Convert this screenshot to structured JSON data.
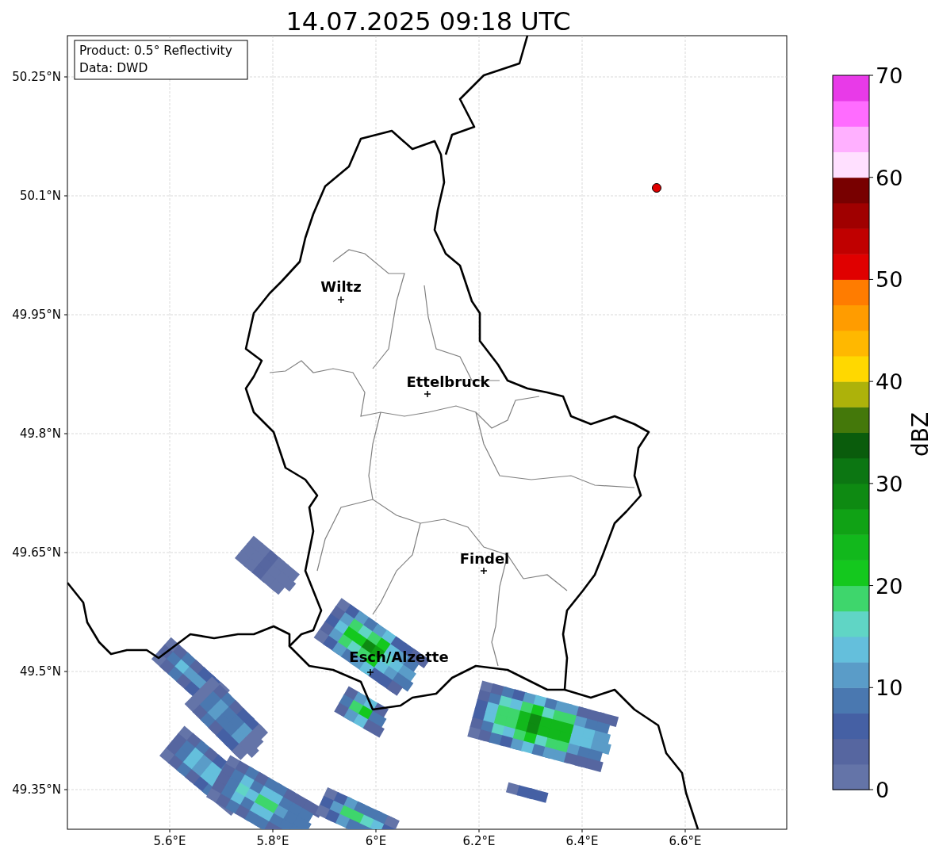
{
  "title": "14.07.2025 09:18 UTC",
  "info_box": [
    "Product: 0.5° Reflectivity",
    "Data: DWD"
  ],
  "cities": [
    {
      "name": "Wiltz"
    },
    {
      "name": "Ettelbruck"
    },
    {
      "name": "Findel"
    },
    {
      "name": "Esch/Alzette"
    }
  ],
  "radar_site": {
    "color": "#e00000"
  },
  "y_ticks": [
    "50.25°N",
    "50.1°N",
    "49.95°N",
    "49.8°N",
    "49.65°N",
    "49.5°N",
    "49.35°N"
  ],
  "x_ticks": [
    "5.6°E",
    "5.8°E",
    "6°E",
    "6.2°E",
    "6.4°E",
    "6.6°E"
  ],
  "colorbar": {
    "label": "dBZ",
    "ticks": [
      "70",
      "60",
      "50",
      "40",
      "30",
      "20",
      "10",
      "0"
    ],
    "bins": [
      {
        "color": "#6474a8"
      },
      {
        "color": "#5666a0"
      },
      {
        "color": "#4560a4"
      },
      {
        "color": "#4a78b0"
      },
      {
        "color": "#5a9cc8"
      },
      {
        "color": "#64bfdc"
      },
      {
        "color": "#60d5c5"
      },
      {
        "color": "#3ed66c"
      },
      {
        "color": "#14c81e"
      },
      {
        "color": "#12b81c"
      },
      {
        "color": "#10a215"
      },
      {
        "color": "#0e8a12"
      },
      {
        "color": "#0c7612"
      },
      {
        "color": "#0a5c0c"
      },
      {
        "color": "#44780a"
      },
      {
        "color": "#adb20a"
      },
      {
        "color": "#ffd800"
      },
      {
        "color": "#ffb800"
      },
      {
        "color": "#ff9c00"
      },
      {
        "color": "#ff7c00"
      },
      {
        "color": "#e00000"
      },
      {
        "color": "#c00000"
      },
      {
        "color": "#a00000"
      },
      {
        "color": "#780000"
      },
      {
        "color": "#ffe0ff"
      },
      {
        "color": "#ffb0ff"
      },
      {
        "color": "#ff6cff"
      },
      {
        "color": "#e83ae8"
      }
    ]
  }
}
